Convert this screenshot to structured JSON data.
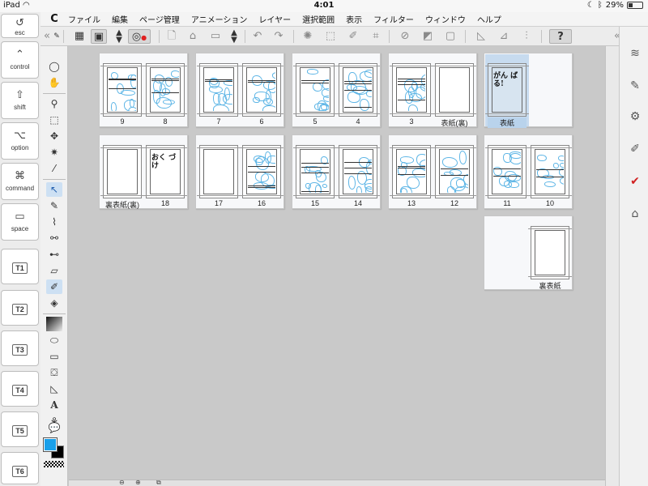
{
  "status_bar": {
    "device": "iPad",
    "time": "4:01",
    "battery": "29%",
    "battery_level": 0.29
  },
  "keys": [
    {
      "id": "esc",
      "label": "esc",
      "icon": "↺"
    },
    {
      "id": "control",
      "label": "control",
      "icon": "⌃"
    },
    {
      "id": "shift",
      "label": "shift",
      "icon": "⇧"
    },
    {
      "id": "option",
      "label": "option",
      "icon": "⌥"
    },
    {
      "id": "command",
      "label": "command",
      "icon": "⌘"
    },
    {
      "id": "space",
      "label": "space",
      "icon": "▭"
    },
    {
      "id": "t1",
      "label": "T1",
      "icon": ""
    },
    {
      "id": "t2",
      "label": "T2",
      "icon": ""
    },
    {
      "id": "t3",
      "label": "T3",
      "icon": ""
    },
    {
      "id": "t4",
      "label": "T4",
      "icon": ""
    },
    {
      "id": "t5",
      "label": "T5",
      "icon": ""
    },
    {
      "id": "t6",
      "label": "T6",
      "icon": ""
    }
  ],
  "menu": {
    "logo": "C",
    "items": [
      "ファイル",
      "編集",
      "ページ管理",
      "アニメーション",
      "レイヤー",
      "選択範囲",
      "表示",
      "フィルター",
      "ウィンドウ",
      "ヘルプ"
    ]
  },
  "toolbar": {
    "collapse_left": "«",
    "collapse_right": "«",
    "help": "?"
  },
  "colors": {
    "main": "#1aa0ea",
    "sub": "#000000",
    "selection": "#b9d3ec",
    "sketch": "#5fb6e6"
  },
  "pages": {
    "spreads": [
      {
        "left": "9",
        "right": "8",
        "left_type": "sketch",
        "right_type": "sketch"
      },
      {
        "left": "7",
        "right": "6",
        "left_type": "sketch",
        "right_type": "sketch"
      },
      {
        "left": "5",
        "right": "4",
        "left_type": "sketch",
        "right_type": "sketch"
      },
      {
        "left": "3",
        "right": "表紙(裏)",
        "left_type": "sketch",
        "right_type": "blank"
      },
      {
        "single": "表紙",
        "type": "hand",
        "hand_text": "がん ばる!",
        "selected": true
      },
      {
        "left": "裏表紙(裏)",
        "right": "18",
        "left_type": "blank",
        "right_type": "hand",
        "right_hand_text": "おく づけ"
      },
      {
        "left": "17",
        "right": "16",
        "left_type": "blank",
        "right_type": "sketch"
      },
      {
        "left": "15",
        "right": "14",
        "left_type": "sketch",
        "right_type": "sketch"
      },
      {
        "left": "13",
        "right": "12",
        "left_type": "sketch",
        "right_type": "sketch"
      },
      {
        "left": "11",
        "right": "10",
        "left_type": "sketch",
        "right_type": "sketch"
      },
      {
        "single": "裏表紙",
        "type": "blank"
      }
    ]
  }
}
